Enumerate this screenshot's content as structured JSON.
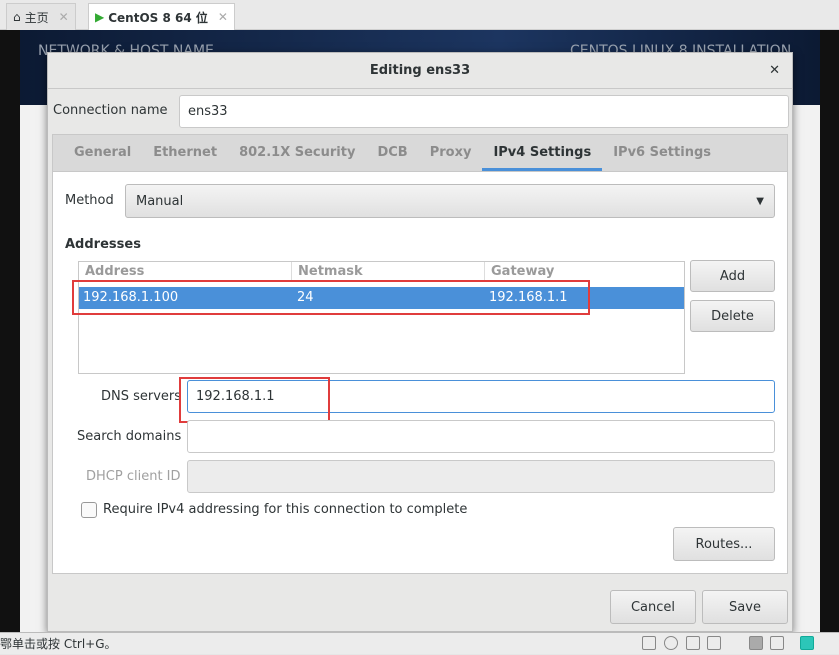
{
  "host_tabs": [
    {
      "label": "主页",
      "icon": "home-icon"
    },
    {
      "label": "CentOS 8 64 位",
      "icon": "vm-icon"
    }
  ],
  "installer": {
    "left_title": "NETWORK & HOST NAME",
    "right_title": "CENTOS LINUX 8 INSTALLATION"
  },
  "dialog": {
    "title": "Editing ens33",
    "connection_name_label": "Connection name",
    "connection_name": "ens33",
    "tabs": [
      {
        "label": "General"
      },
      {
        "label": "Ethernet"
      },
      {
        "label": "802.1X Security"
      },
      {
        "label": "DCB"
      },
      {
        "label": "Proxy"
      },
      {
        "label": "IPv4 Settings",
        "active": true
      },
      {
        "label": "IPv6 Settings"
      }
    ],
    "method_label": "Method",
    "method_value": "Manual",
    "addresses_label": "Addresses",
    "columns": [
      "Address",
      "Netmask",
      "Gateway"
    ],
    "rows": [
      {
        "address": "192.168.1.100",
        "netmask": "24",
        "gateway": "192.168.1.1"
      }
    ],
    "add": "Add",
    "delete": "Delete",
    "dns_label": "DNS servers",
    "dns_value": "192.168.1.1",
    "search_label": "Search domains",
    "search_value": "",
    "dhcp_label": "DHCP client ID",
    "dhcp_value": "",
    "require_label": "Require IPv4 addressing for this connection to complete",
    "require_checked": false,
    "routes": "Routes...",
    "cancel": "Cancel",
    "save": "Save"
  },
  "statusbar": {
    "text": "鄂单击或按 Ctrl+G。"
  },
  "colors": {
    "accent": "#4a90d9",
    "highlight": "#e03c3c"
  }
}
